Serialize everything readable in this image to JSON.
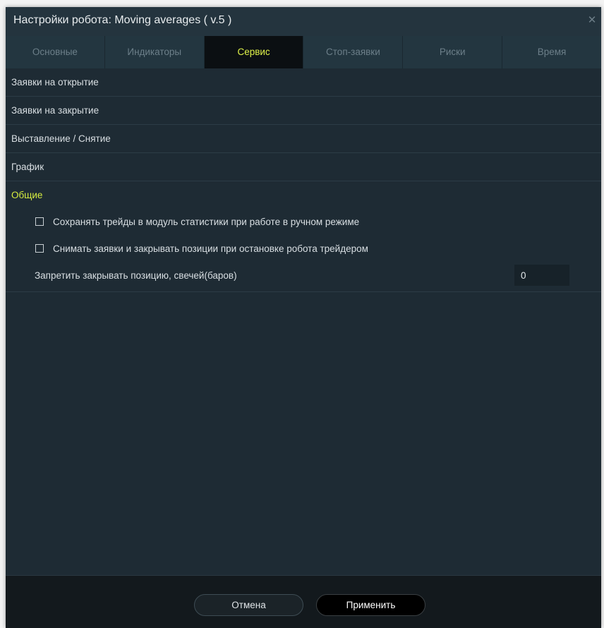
{
  "window": {
    "title": "Настройки робота: Moving averages ( v.5 )",
    "close_glyph": "✕"
  },
  "tabs": [
    {
      "label": "Основные",
      "active": false
    },
    {
      "label": "Индикаторы",
      "active": false
    },
    {
      "label": "Сервис",
      "active": true
    },
    {
      "label": "Стоп-заявки",
      "active": false
    },
    {
      "label": "Риски",
      "active": false
    },
    {
      "label": "Время",
      "active": false
    }
  ],
  "sections": [
    {
      "label": "Заявки на открытие"
    },
    {
      "label": "Заявки на закрытие"
    },
    {
      "label": "Выставление / Снятие"
    },
    {
      "label": "График"
    },
    {
      "label": "Общие",
      "active": true
    }
  ],
  "general": {
    "save_trades_label": "Сохранять трейды в модуль статистики при работе в ручном режиме",
    "save_trades_checked": false,
    "cancel_orders_label": "Снимать заявки и закрывать позиции при остановке робота трейдером",
    "cancel_orders_checked": false,
    "forbid_close_label": "Запретить закрывать позицию, свечей(баров)",
    "forbid_close_value": "0"
  },
  "footer": {
    "cancel_label": "Отмена",
    "apply_label": "Применить"
  },
  "colors": {
    "background": "#1e2b34",
    "tab_bar": "#233640",
    "active_tab": "#0b0f12",
    "accent": "#d6ec3f",
    "footer": "#13191d"
  },
  "icons": {
    "close": "close-icon",
    "checkbox": "checkbox-icon"
  }
}
